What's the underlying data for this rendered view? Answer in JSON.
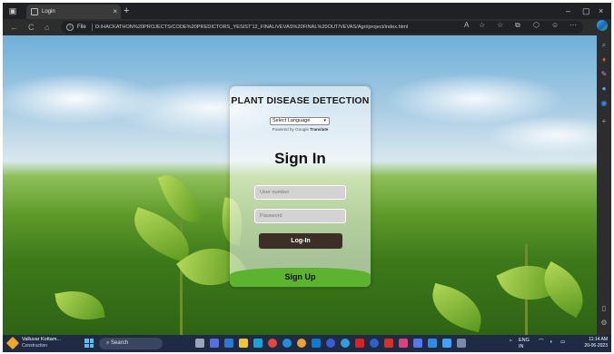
{
  "browser": {
    "tab": {
      "title": "Login",
      "close_glyph": "×"
    },
    "new_tab_glyph": "+",
    "window_controls": {
      "minimize": "–",
      "maximize": "▢",
      "close": "×"
    },
    "nav": {
      "back": "←",
      "refresh": "C",
      "home": "⌂"
    },
    "address": {
      "scheme": "File",
      "url": "D:/HACKATHON%20PROJECTS/CODE%20PREDICTORS_YESIST'12_FINAL/VEVAS%20FINAL%20OUT/VEVAS/Agri/project/index.html"
    },
    "toolbar_icons": [
      "read-aloud-icon",
      "favorite-star-icon",
      "favorites-icon",
      "collections-icon",
      "extensions-icon",
      "profile-icon",
      "more-icon"
    ]
  },
  "sidebar": {
    "icons": [
      "search-icon",
      "shopping-icon",
      "tools-icon",
      "games-icon",
      "outlook-icon",
      "add-icon",
      "sidebar-toggle-icon",
      "settings-icon"
    ]
  },
  "login": {
    "title": "PLANT DISEASE DETECTION",
    "language_select": "Select Language",
    "powered_by": "Powered by",
    "google": "Google",
    "translate": "Translate",
    "heading": "Sign In",
    "user_placeholder": "User number",
    "password_placeholder": "Password",
    "login_button": "Log-In",
    "signup_button": "Sign Up"
  },
  "taskbar": {
    "weather_title": "Valluvar Kottam...",
    "weather_sub": "Construction",
    "search_label": "Search",
    "tray_lang_1": "ENG",
    "tray_lang_2": "IN",
    "time": "11:14 AM",
    "date": "20-06-2023",
    "colors": {
      "accent": "#4cc2ff",
      "brand_green": "#5cb32e",
      "login_brown": "#3d2f26"
    }
  }
}
